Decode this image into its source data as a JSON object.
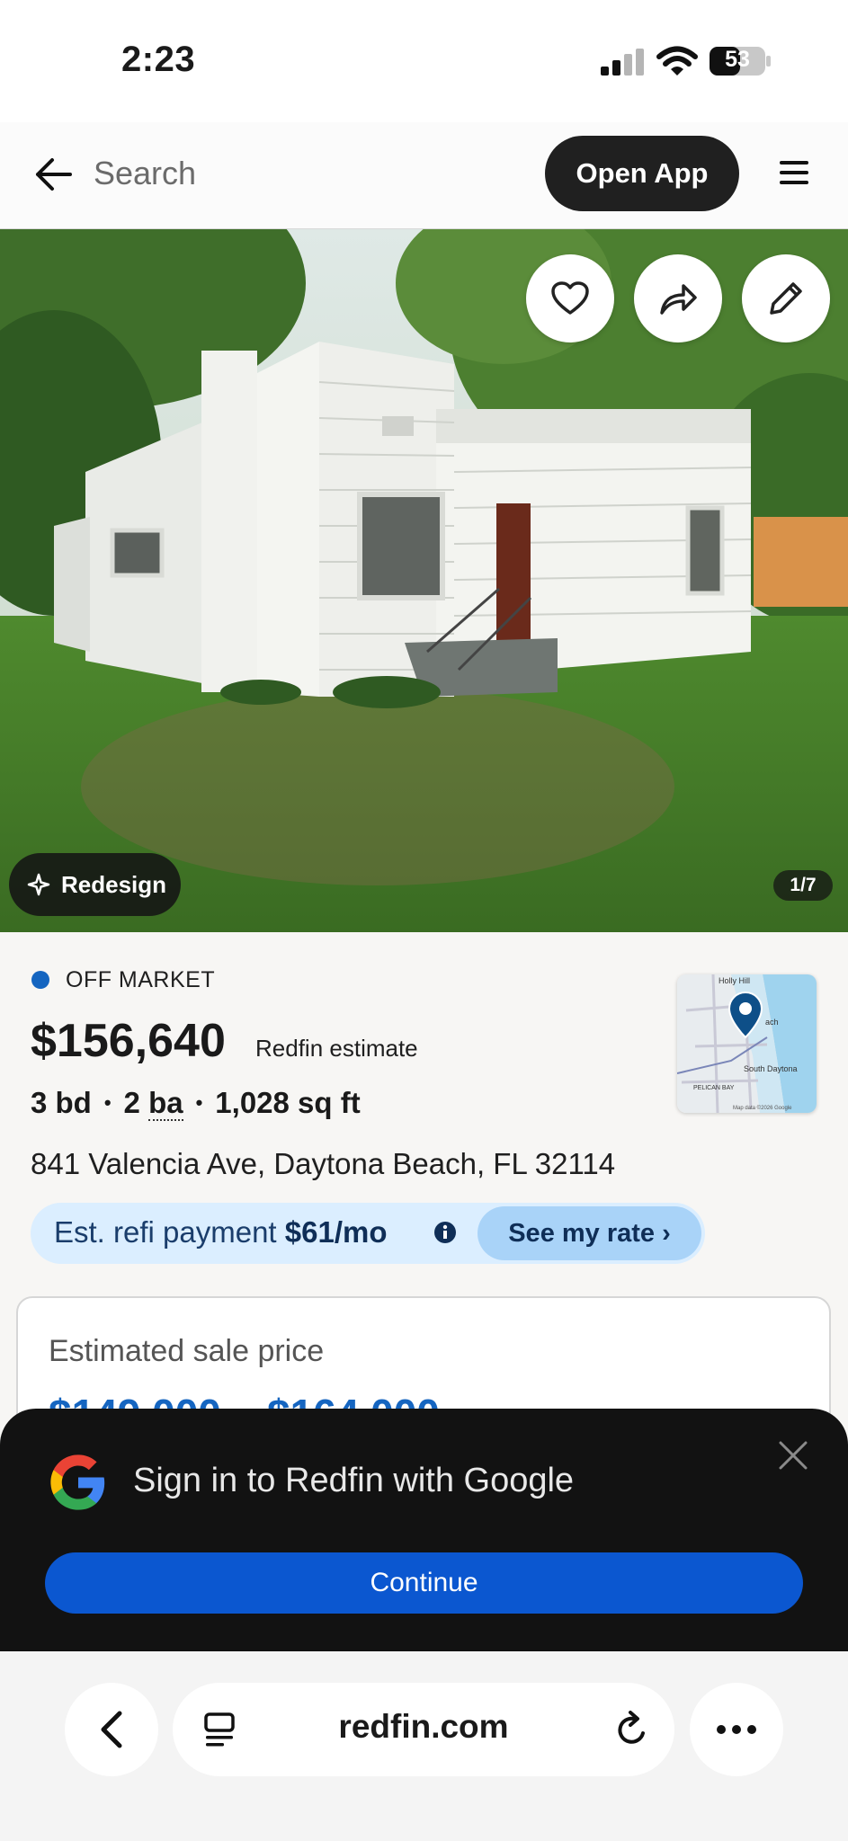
{
  "status_bar": {
    "time": "2:23",
    "battery": "53"
  },
  "top_nav": {
    "search_placeholder": "Search",
    "open_app_label": "Open App"
  },
  "photo": {
    "redesign_label": "Redesign",
    "counter": "1/7"
  },
  "listing": {
    "status": "OFF MARKET",
    "price": "$156,640",
    "price_label": "Redfin estimate",
    "beds": "3 bd",
    "baths_value": "2",
    "baths_unit": "ba",
    "sqft": "1,028 sq ft",
    "address": "841 Valencia Ave, Daytona Beach, FL 32114",
    "refi_label": "Est. refi payment",
    "refi_amount": "$61/mo",
    "rate_button": "See my rate ›",
    "estimate_card_title": "Estimated sale price",
    "estimate_range": "$149,000 – $164,000"
  },
  "map": {
    "label_top": "Holly Hill",
    "label_beach": "ach",
    "label_south": "South Daytona",
    "label_pelican": "PELICAN BAY",
    "attribution": "Map data ©2026 Google"
  },
  "google_sheet": {
    "title": "Sign in to Redfin with Google",
    "continue_label": "Continue"
  },
  "browser": {
    "url": "redfin.com"
  },
  "colors": {
    "accent_blue": "#1565c0",
    "google_button": "#0b57d0",
    "refi_bg": "#dbeeff"
  }
}
